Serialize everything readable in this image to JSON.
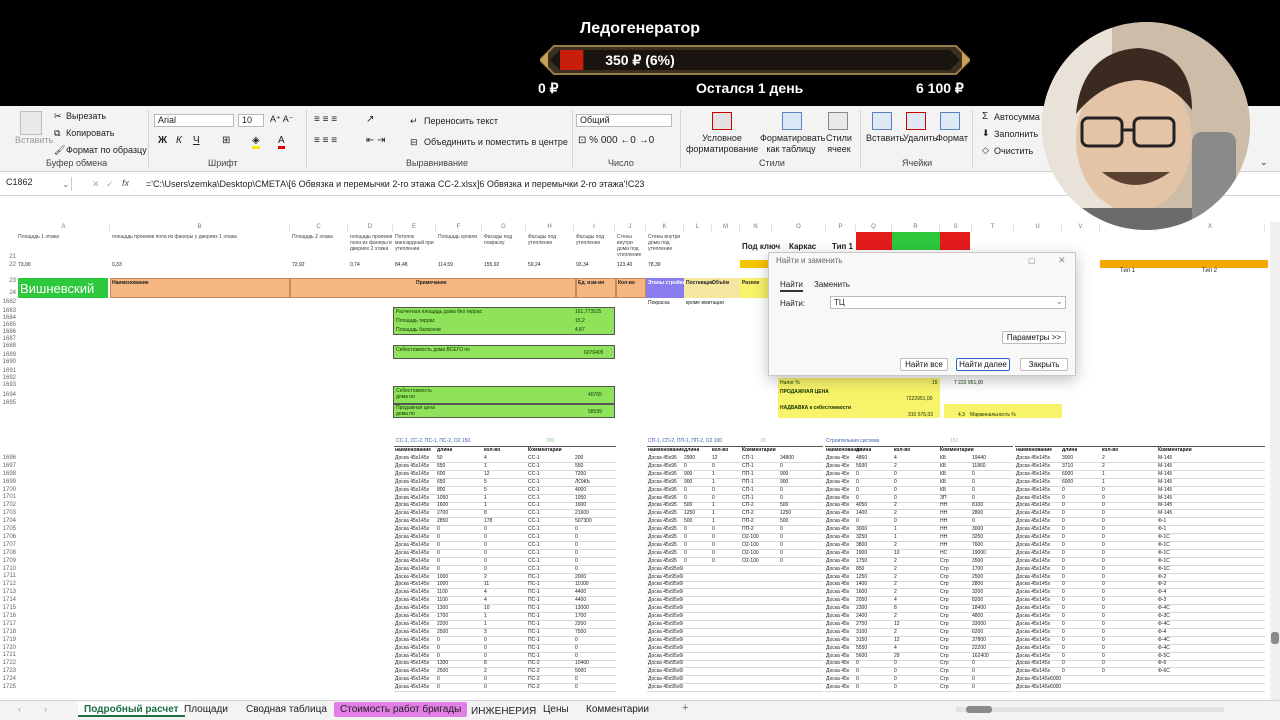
{
  "overlay": {
    "title": "Ледогенератор",
    "amount": "350 ₽ (6%)",
    "progress_fraction": 0.06,
    "min": "0 ₽",
    "time_left": "Остался 1 день",
    "max": "6 100 ₽",
    "bar_fill_color": "#c81e0c"
  },
  "ribbon": {
    "clipboard": {
      "paste": "Вставить",
      "cut": "Вырезать",
      "copy": "Копировать",
      "format_painter": "Формат по образцу",
      "group": "Буфер обмена"
    },
    "font": {
      "name": "Arial",
      "size": "10",
      "bold": "Ж",
      "italic": "К",
      "underline": "Ч",
      "group": "Шрифт"
    },
    "alignment": {
      "wrap": "Переносить текст",
      "merge": "Объединить и поместить в центре",
      "group": "Выравнивание"
    },
    "number": {
      "format": "Общий",
      "group": "Число"
    },
    "styles": {
      "conditional": "Условное форматирование",
      "as_table": "Форматировать как таблицу",
      "cell_styles": "Стили ячеек",
      "group": "Стили"
    },
    "cells": {
      "insert": "Вставить",
      "delete": "Удалить",
      "format": "Формат",
      "group": "Ячейки"
    },
    "editing": {
      "autosum": "Автосумма",
      "fill": "Заполнить",
      "clear": "Очистить"
    }
  },
  "formula_bar": {
    "name_box": "C1862",
    "fx": "fx",
    "formula": "='C:\\Users\\zemka\\Desktop\\СМЕТА\\[6 Обвязка и перемычки 2-го этажа СС-2.xlsx]6 Обвязка и перемычки 2-го этажа'!C23"
  },
  "grid": {
    "columns": [
      "A",
      "B",
      "C",
      "D",
      "E",
      "F",
      "G",
      "H",
      "I",
      "J",
      "K",
      "L",
      "M",
      "N",
      "O",
      "P",
      "Q",
      "R",
      "S",
      "T",
      "U",
      "V",
      "W",
      "X"
    ],
    "top_row_labels": [
      "Площадь 1 этажа",
      "площадь проемов пола из фанеры у двериях 1 этажа",
      "Площадь 2 этажа",
      "площадь проемов пола из фанеры в двериях 2 этажа",
      "Потолок мансардный при утеплении",
      "Площадь кровли",
      "Фасады под покраску",
      "Фасады под утепление",
      "Фасады под утепление",
      "Стены внутри дома под утепление",
      "Стены внутри дома под утепление"
    ],
    "row22_values": [
      "73,00",
      "0,33",
      "72,92",
      "0,74",
      "84,48",
      "114,59",
      "155,92",
      "59,24",
      "93,34",
      "123,40",
      "78,39"
    ],
    "key_labels": [
      "Под ключ",
      "Каркас",
      "Тип 1"
    ],
    "type_labels": [
      "Тип 1",
      "Тип 2"
    ],
    "name_cell": "Вишневский",
    "header_titles": [
      "Наименование",
      "Примечание",
      "Ед. изм-ия",
      "Кол-во",
      "Этапы стройки",
      "Поставщик",
      "Объём",
      "Разное"
    ],
    "header_notes": [
      "Покраска",
      "кроме имитации"
    ],
    "summary": {
      "area_label": "Расчетная площадь дома без террас",
      "area_value": "161,773525",
      "terrace_label": "Площадь террас",
      "terrace_value": "15,2",
      "balcony_label": "Площадь балконов",
      "balcony_value": "4,87",
      "cost_label": "Себестоимость дома ВСЕГО по",
      "cost_value": "6076405",
      "cost_per_label": "Себестоимость дома по",
      "cost_per_value": "40765",
      "price_label": "Продажная цена дома по",
      "price_value": "58599"
    },
    "tax": {
      "tax_label": "Налог %",
      "tax_value": "15",
      "price_label": "ПРОДАЖНАЯ ЦЕНА",
      "price_value": "7222951,00",
      "price_right": "7 222 951,00",
      "markup_label": "НАДБАВКА к себестоимости",
      "markup_value": "310 576,03",
      "margin_value": "4,3",
      "margin_label": "Маржинальность %"
    },
    "section_titles": [
      "СС-1, СС-2, ПС-1, ПС-2, О2 150",
      "СП-1, СП-2, ПП-1, ПП-2, О2 100",
      "Строительная система"
    ],
    "section_counts": [
      "200",
      "18",
      "151"
    ],
    "table_headers": [
      "наименование",
      "длина",
      "кол-во",
      "Комментарии"
    ],
    "rows": [
      "1682",
      "1683",
      "1684",
      "1685",
      "1686",
      "1687",
      "1688",
      "1689",
      "1690",
      "1691",
      "1692",
      "1693",
      "1694",
      "1695",
      "1696",
      "1697",
      "1698",
      "1699",
      "1700",
      "1701",
      "1702",
      "1703",
      "1704",
      "1705",
      "1706",
      "1707",
      "1708",
      "1709",
      "1710",
      "1711",
      "1712",
      "1713",
      "1714",
      "1715",
      "1716",
      "1717",
      "1718",
      "1719",
      "1720",
      "1721",
      "1722",
      "1723",
      "1724",
      "1725"
    ],
    "t1": [
      [
        "Доска 45х145х",
        "50",
        "4",
        "СС-1",
        "200"
      ],
      [
        "Доска 45х145х",
        "550",
        "1",
        "СС-1",
        "550"
      ],
      [
        "Доска 45х145х",
        "600",
        "12",
        "СС-1",
        "7200"
      ],
      [
        "Доска 45х145х",
        "650",
        "5",
        "СС-1",
        "ЛОЖЬ"
      ],
      [
        "Доска 45х145х",
        "800",
        "5",
        "СС-1",
        "4000"
      ],
      [
        "Доска 45х145х",
        "1050",
        "1",
        "СС-1",
        "1050"
      ],
      [
        "Доска 45х145х",
        "1600",
        "1",
        "СС-1",
        "1600"
      ],
      [
        "Доска 45х145х",
        "2700",
        "8",
        "СС-1",
        "21600"
      ],
      [
        "Доска 45х145х",
        "2850",
        "178",
        "СС-1",
        "507300"
      ],
      [
        "Доска 45х145х",
        "0",
        "0",
        "СС-1",
        "0"
      ],
      [
        "Доска 45х145х",
        "0",
        "0",
        "СС-1",
        "0"
      ],
      [
        "Доска 45х145х",
        "0",
        "0",
        "СС-1",
        "0"
      ],
      [
        "Доска 45х145х",
        "0",
        "0",
        "СС-1",
        "0"
      ],
      [
        "Доска 45х145х",
        "0",
        "0",
        "СС-1",
        "0"
      ],
      [
        "Доска 45х145х",
        "0",
        "0",
        "СС-1",
        "0"
      ],
      [
        "Доска 45х145х",
        "1000",
        "2",
        "ПС-1",
        "2000"
      ],
      [
        "Доска 45х145х",
        "1000",
        "11",
        "ПС-1",
        "11000"
      ],
      [
        "Доска 45х145х",
        "1100",
        "4",
        "ПС-1",
        "4400"
      ],
      [
        "Доска 45х145х",
        "1100",
        "4",
        "ПС-1",
        "4400"
      ],
      [
        "Доска 45х145х",
        "1300",
        "10",
        "ПС-1",
        "13000"
      ],
      [
        "Доска 45х145х",
        "1700",
        "1",
        "ПС-1",
        "1700"
      ],
      [
        "Доска 45х145х",
        "2200",
        "1",
        "ПС-1",
        "2200"
      ],
      [
        "Доска 45х145х",
        "2500",
        "3",
        "ПС-1",
        "7500"
      ],
      [
        "Доска 45х145х",
        "0",
        "0",
        "ПС-1",
        "0"
      ],
      [
        "Доска 45х145х",
        "0",
        "0",
        "ПС-1",
        "0"
      ],
      [
        "Доска 45х145х",
        "0",
        "0",
        "ПС-1",
        "0"
      ],
      [
        "Доска 45х145х",
        "1300",
        "8",
        "ПС-2",
        "10400"
      ],
      [
        "Доска 45х145х",
        "2500",
        "2",
        "ПС-2",
        "5000"
      ],
      [
        "Доска 45х145х",
        "0",
        "0",
        "ПС-2",
        "0"
      ],
      [
        "Доска 45х145х",
        "0",
        "0",
        "ПС-2",
        "0"
      ]
    ],
    "t2": [
      [
        "Доска 45х95",
        "2900",
        "12",
        "СП-1",
        "34800"
      ],
      [
        "Доска 45х95",
        "0",
        "0",
        "СП-1",
        "0"
      ],
      [
        "Доска 45х95",
        "900",
        "1",
        "ПП-1",
        "900"
      ],
      [
        "Доска 45х95",
        "900",
        "1",
        "ПП-1",
        "900"
      ],
      [
        "Доска 45х95",
        "0",
        "0",
        "СП-1",
        "0"
      ],
      [
        "Доска 45х95",
        "0",
        "0",
        "СП-1",
        "0"
      ],
      [
        "Доска 45х95",
        "500",
        "1",
        "СП-2",
        "500"
      ],
      [
        "Доска 45х95",
        "1250",
        "1",
        "СП-2",
        "1250"
      ],
      [
        "Доска 45х95",
        "500",
        "1",
        "ПП-2",
        "500"
      ],
      [
        "Доска 45х95",
        "0",
        "0",
        "ПП-2",
        "0"
      ],
      [
        "Доска 45х95",
        "0",
        "0",
        "О2-100",
        "0"
      ],
      [
        "Доска 45х95",
        "0",
        "0",
        "О2-100",
        "0"
      ],
      [
        "Доска 45х95",
        "0",
        "0",
        "О2-100",
        "0"
      ],
      [
        "Доска 45х95",
        "0",
        "0",
        "О2-100",
        "0"
      ],
      [
        "Доска 45х95х6000",
        "",
        "",
        "",
        ""
      ],
      [
        "Доска 45х95х6000",
        "",
        "",
        "",
        ""
      ],
      [
        "Доска 45х95х6000",
        "",
        "",
        "",
        ""
      ],
      [
        "Доска 45х95х6000",
        "",
        "",
        "",
        ""
      ],
      [
        "Доска 45х95х6000",
        "",
        "",
        "",
        ""
      ],
      [
        "Доска 45х95х6000",
        "",
        "",
        "",
        ""
      ],
      [
        "Доска 45х95х6000",
        "",
        "",
        "",
        ""
      ],
      [
        "Доска 45х95х6000",
        "",
        "",
        "",
        ""
      ],
      [
        "Доска 45х95х6000",
        "",
        "",
        "",
        ""
      ],
      [
        "Доска 45х95х6000",
        "",
        "",
        "",
        ""
      ],
      [
        "Доска 45х95х6000",
        "",
        "",
        "",
        ""
      ],
      [
        "Доска 45х95х6000",
        "",
        "",
        "",
        ""
      ],
      [
        "Доска 45х95х6000",
        "",
        "",
        "",
        ""
      ],
      [
        "Доска 45х95х6000",
        "",
        "",
        "",
        ""
      ],
      [
        "Доска 45х95х6000",
        "",
        "",
        "",
        ""
      ],
      [
        "Доска 45х95х6000",
        "",
        "",
        "",
        ""
      ]
    ],
    "t3": [
      [
        "Доска 45х",
        "4860",
        "4",
        "КБ",
        "19440"
      ],
      [
        "Доска 45х",
        "5930",
        "2",
        "КБ",
        "11860"
      ],
      [
        "Доска 45х",
        "0",
        "0",
        "КБ",
        "0"
      ],
      [
        "Доска 45х",
        "0",
        "0",
        "КБ",
        "0"
      ],
      [
        "Доска 45х",
        "0",
        "0",
        "КБ",
        "0"
      ],
      [
        "Доска 45х",
        "0",
        "0",
        "ЗП",
        "0"
      ],
      [
        "Доска 45х",
        "4050",
        "2",
        "НН",
        "8100"
      ],
      [
        "Доска 45х",
        "1400",
        "2",
        "НН",
        "2800"
      ],
      [
        "Доска 45х",
        "0",
        "0",
        "НН",
        "0"
      ],
      [
        "Доска 45х",
        "3000",
        "1",
        "НН",
        "3000"
      ],
      [
        "Доска 45х",
        "3250",
        "1",
        "НН",
        "3250"
      ],
      [
        "Доска 45х",
        "3800",
        "2",
        "НН",
        "7600"
      ],
      [
        "Доска 45х",
        "1900",
        "10",
        "НС",
        "19000"
      ],
      [
        "Доска 45х",
        "1750",
        "2",
        "Стр",
        "3500"
      ],
      [
        "Доска 45х",
        "850",
        "2",
        "Стр",
        "1700"
      ],
      [
        "Доска 45х",
        "1250",
        "2",
        "Стр",
        "2500"
      ],
      [
        "Доска 45х",
        "1400",
        "2",
        "Стр",
        "2800"
      ],
      [
        "Доска 45х",
        "1600",
        "2",
        "Стр",
        "3200"
      ],
      [
        "Доска 45х",
        "2050",
        "4",
        "Стр",
        "8200"
      ],
      [
        "Доска 45х",
        "2300",
        "8",
        "Стр",
        "18400"
      ],
      [
        "Доска 45х",
        "2400",
        "2",
        "Стр",
        "4800"
      ],
      [
        "Доска 45х",
        "2750",
        "12",
        "Стр",
        "33000"
      ],
      [
        "Доска 45х",
        "3100",
        "2",
        "Стр",
        "6200"
      ],
      [
        "Доска 45х",
        "3150",
        "12",
        "Стр",
        "37800"
      ],
      [
        "Доска 45х",
        "5550",
        "4",
        "Стр",
        "22200"
      ],
      [
        "Доска 45х",
        "5600",
        "29",
        "Стр",
        "162400"
      ],
      [
        "Доска 45х",
        "0",
        "0",
        "Стр",
        "0"
      ],
      [
        "Доска 45х",
        "0",
        "0",
        "Стр",
        "0"
      ],
      [
        "Доска 45х",
        "0",
        "0",
        "Стр",
        "0"
      ],
      [
        "Доска 45х",
        "0",
        "0",
        "Стр",
        "0"
      ]
    ],
    "t4": [
      [
        "Доска 45х145х",
        "3000",
        "2",
        "М-145"
      ],
      [
        "Доска 45х145х",
        "3710",
        "2",
        "М-145"
      ],
      [
        "Доска 45х145х",
        "6000",
        "1",
        "М-145"
      ],
      [
        "Доска 45х145х",
        "6000",
        "1",
        "М-145"
      ],
      [
        "Доска 45х145х",
        "0",
        "0",
        "М-145"
      ],
      [
        "Доска 45х145х",
        "0",
        "0",
        "М-145"
      ],
      [
        "Доска 45х145х",
        "0",
        "0",
        "М-145"
      ],
      [
        "Доска 45х145х",
        "0",
        "0",
        "М-145"
      ],
      [
        "Доска 45х145х",
        "0",
        "0",
        "Ф-1"
      ],
      [
        "Доска 45х145х",
        "0",
        "0",
        "Ф-1"
      ],
      [
        "Доска 45х145х",
        "0",
        "0",
        "Ф-1С"
      ],
      [
        "Доска 45х145х",
        "0",
        "0",
        "Ф-1С"
      ],
      [
        "Доска 45х145х",
        "0",
        "0",
        "Ф-1С"
      ],
      [
        "Доска 45х145х",
        "0",
        "0",
        "Ф-1С"
      ],
      [
        "Доска 45х145х",
        "0",
        "0",
        "Ф-1С"
      ],
      [
        "Доска 45х145х",
        "0",
        "0",
        "Ф-2"
      ],
      [
        "Доска 45х145х",
        "0",
        "0",
        "Ф-2"
      ],
      [
        "Доска 45х145х",
        "0",
        "0",
        "Ф-4"
      ],
      [
        "Доска 45х145х",
        "0",
        "0",
        "Ф-3"
      ],
      [
        "Доска 45х145х",
        "0",
        "0",
        "Ф-4С"
      ],
      [
        "Доска 45х145х",
        "0",
        "0",
        "Ф-3С"
      ],
      [
        "Доска 45х145х",
        "0",
        "0",
        "Ф-4С"
      ],
      [
        "Доска 45х145х",
        "0",
        "0",
        "Ф-4"
      ],
      [
        "Доска 45х145х",
        "0",
        "0",
        "Ф-4С"
      ],
      [
        "Доска 45х145х",
        "0",
        "0",
        "Ф-4С"
      ],
      [
        "Доска 45х145х",
        "0",
        "0",
        "Ф-5С"
      ],
      [
        "Доска 45х145х",
        "0",
        "0",
        "Ф-6"
      ],
      [
        "Доска 45х145х",
        "0",
        "0",
        "Ф-6С"
      ],
      [
        "Доска 45х145х6000",
        "",
        "",
        ""
      ],
      [
        "Доска 45х145х6000",
        "",
        "",
        ""
      ]
    ]
  },
  "dialog": {
    "title": "Найти и заменить",
    "tab_find": "Найти",
    "tab_replace": "Заменить",
    "find_label": "Найти:",
    "find_value": "ТЦ",
    "params": "Параметры >>",
    "find_all": "Найти все",
    "find_next": "Найти далее",
    "close": "Закрыть"
  },
  "sheets": {
    "tabs": [
      "Подробный расчет",
      "Площади",
      "Сводная таблица",
      "Стоимость работ бригады",
      "ИНЖЕНЕРИЯ",
      "Цены",
      "Комментарии"
    ],
    "active_index": 0,
    "highlight_color": "#e37ee6",
    "add": "+"
  }
}
